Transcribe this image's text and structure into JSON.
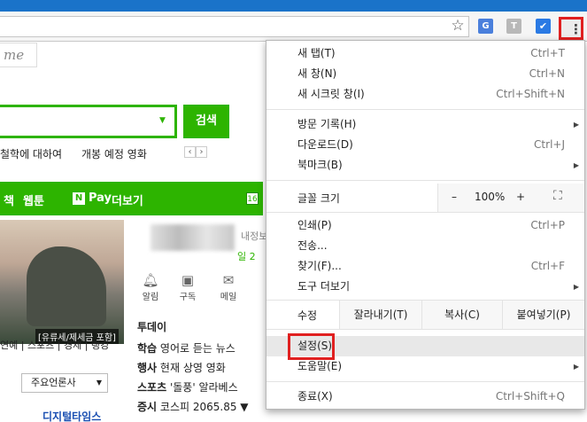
{
  "browser": {
    "icons": [
      "star-icon",
      "translate-extension-icon",
      "t-extension-icon",
      "checkmark-extension-icon",
      "more-vert-icon"
    ],
    "ext_t_label": "T",
    "accent_highlight": "#e02020"
  },
  "page": {
    "me_tab": "me",
    "search_button": "검색",
    "related": [
      "철학에 대하여",
      "개봉 예정 영화"
    ],
    "pager": [
      "‹",
      "›"
    ],
    "nav": {
      "items": [
        "책",
        "웹툰",
        "Pay",
        "더보기"
      ],
      "npay_badge": "N",
      "badge": "16"
    },
    "banner_caption": "[유류세/제세금 포함]",
    "sections": "연예 | 스포츠 | 경제 | 랭킹",
    "press_select": "주요언론사",
    "press_logo": "디지털타임스",
    "side_label": "내정보",
    "side_label2": "일 2",
    "mini_icons": [
      {
        "label": "알림",
        "icon": "bell-icon"
      },
      {
        "label": "구독",
        "icon": "subscribe-icon"
      },
      {
        "label": "메일",
        "icon": "mail-icon"
      }
    ],
    "today": "투데이",
    "news": [
      {
        "cat": "학습",
        "text": "영어로 듣는 뉴스"
      },
      {
        "cat": "행사",
        "text": "현재 상영 영화"
      },
      {
        "cat": "스포츠",
        "text": "'돌풍' 알라베스"
      },
      {
        "cat": "증시",
        "text": "코스피 2065.85 ▼"
      }
    ]
  },
  "menu": {
    "new_tab": {
      "label": "새 탭(T)",
      "shortcut": "Ctrl+T"
    },
    "new_window": {
      "label": "새 창(N)",
      "shortcut": "Ctrl+N"
    },
    "incognito": {
      "label": "새 시크릿 창(I)",
      "shortcut": "Ctrl+Shift+N"
    },
    "history": {
      "label": "방문 기록(H)"
    },
    "downloads": {
      "label": "다운로드(D)",
      "shortcut": "Ctrl+J"
    },
    "bookmarks": {
      "label": "북마크(B)"
    },
    "zoom": {
      "label": "글꼴 크기",
      "minus": "–",
      "value": "100%",
      "plus": "+"
    },
    "print": {
      "label": "인쇄(P)",
      "shortcut": "Ctrl+P"
    },
    "cast": {
      "label": "전송..."
    },
    "find": {
      "label": "찾기(F)...",
      "shortcut": "Ctrl+F"
    },
    "more_tools": {
      "label": "도구 더보기"
    },
    "edit": {
      "label": "수정",
      "cut": "잘라내기(T)",
      "copy": "복사(C)",
      "paste": "붙여넣기(P)"
    },
    "settings": {
      "label": "설정(S)"
    },
    "help": {
      "label": "도움말(E)"
    },
    "exit": {
      "label": "종료(X)",
      "shortcut": "Ctrl+Shift+Q"
    }
  }
}
